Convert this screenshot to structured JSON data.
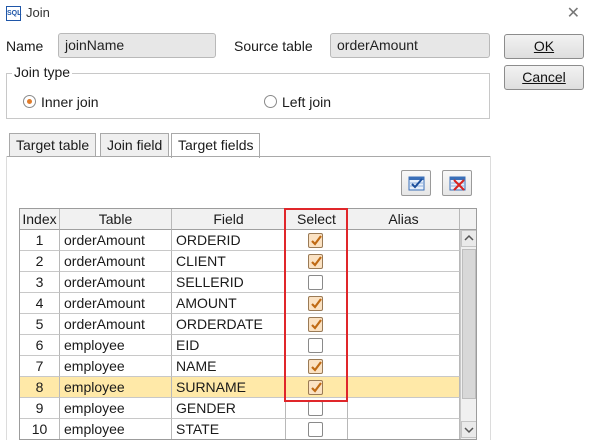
{
  "window": {
    "title": "Join",
    "icon": "app-icon",
    "close_icon": "close-icon"
  },
  "form": {
    "name_label": "Name",
    "name_value": "joinName",
    "source_label": "Source table",
    "source_value": "orderAmount"
  },
  "buttons": {
    "ok": "OK",
    "cancel": "Cancel"
  },
  "join_type": {
    "legend": "Join type",
    "options": [
      {
        "label": "Inner join",
        "selected": true
      },
      {
        "label": "Left join",
        "selected": false
      }
    ]
  },
  "tabs": [
    {
      "label": "Target table",
      "active": false
    },
    {
      "label": "Join field",
      "active": false
    },
    {
      "label": "Target fields",
      "active": true
    }
  ],
  "toolbar": {
    "select_all_icon": "select-all-icon",
    "clear_icon": "deselect-all-icon"
  },
  "table": {
    "columns": [
      "Index",
      "Table",
      "Field",
      "Select",
      "Alias"
    ],
    "rows": [
      {
        "index": "1",
        "table": "orderAmount",
        "field": "ORDERID",
        "select": true,
        "alias": ""
      },
      {
        "index": "2",
        "table": "orderAmount",
        "field": "CLIENT",
        "select": true,
        "alias": ""
      },
      {
        "index": "3",
        "table": "orderAmount",
        "field": "SELLERID",
        "select": false,
        "alias": ""
      },
      {
        "index": "4",
        "table": "orderAmount",
        "field": "AMOUNT",
        "select": true,
        "alias": ""
      },
      {
        "index": "5",
        "table": "orderAmount",
        "field": "ORDERDATE",
        "select": true,
        "alias": ""
      },
      {
        "index": "6",
        "table": "employee",
        "field": "EID",
        "select": false,
        "alias": ""
      },
      {
        "index": "7",
        "table": "employee",
        "field": "NAME",
        "select": true,
        "alias": ""
      },
      {
        "index": "8",
        "table": "employee",
        "field": "SURNAME",
        "select": true,
        "alias": ""
      },
      {
        "index": "9",
        "table": "employee",
        "field": "GENDER",
        "select": false,
        "alias": ""
      },
      {
        "index": "10",
        "table": "employee",
        "field": "STATE",
        "select": false,
        "alias": ""
      }
    ],
    "selected_row_index": "8",
    "highlight_color": "#e0262a"
  }
}
